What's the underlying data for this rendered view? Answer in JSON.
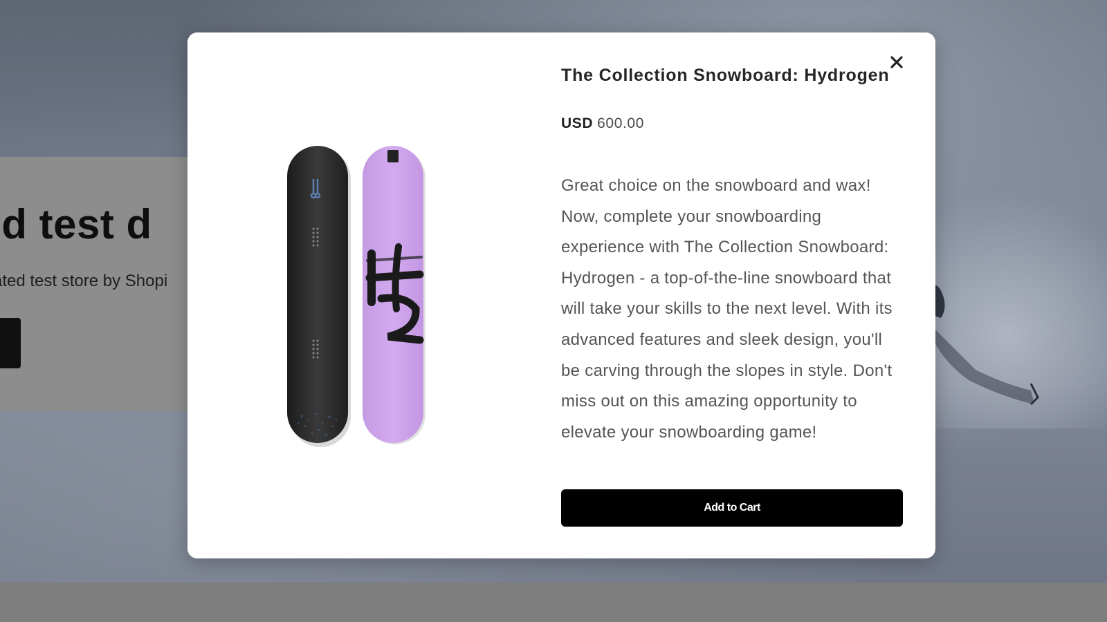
{
  "background": {
    "hero_title": "ted test d",
    "hero_subtitle": "ated test store by Shopi"
  },
  "modal": {
    "title": "The Collection Snowboard: Hydrogen",
    "price_currency": "USD",
    "price_amount": "600.00",
    "description": "Great choice on the snowboard and wax! Now, complete your snowboarding experience with The Collection Snowboard: Hydrogen - a top-of-the-line snowboard that will take your skills to the next level. With its advanced features and sleek design, you'll be carving through the slopes in style. Don't miss out on this amazing opportunity to elevate your snowboarding game!",
    "add_to_cart_label": "Add to Cart",
    "close_icon": "close-icon",
    "product_image": "snowboard-pair-black-and-lavender"
  },
  "colors": {
    "button_bg": "#000000",
    "board_dark": "#2b2b2b",
    "board_lavender": "#c89ee6"
  }
}
